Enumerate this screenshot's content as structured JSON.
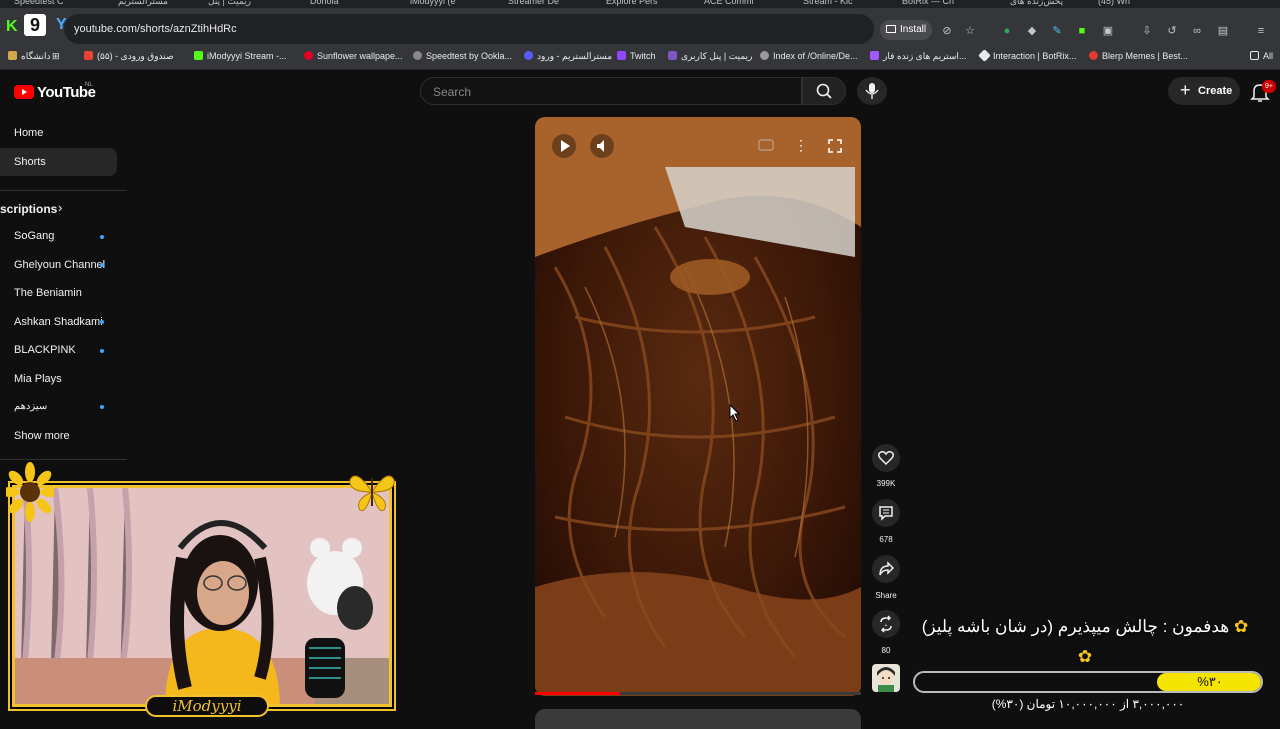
{
  "browser": {
    "tabs": [
      "Speedtest C",
      "مسترالستریم",
      "ریمیت | پنل",
      "Donola",
      "iModyyyi (e",
      "Streamer De",
      "Explore Pers",
      "ACE Commi",
      "Stream - Kic",
      "BotRix — Ch",
      "پخش‌زنده های",
      "(45) Wh"
    ],
    "url": "youtube.com/shorts/aznZtihHdRc",
    "install_label": "Install",
    "bookmarks": [
      "دانشگاه",
      "صندوق ورودی - (۵۵)",
      "iModyyyi Stream -...",
      "Sunflower wallpape...",
      "Speedtest by Ookla...",
      "مسترالستریم - ورود",
      "Twitch",
      "ریمیت | پنل کاربری",
      "Index of /Online/De...",
      "استریم های زنده فار...",
      "Interaction | BotRix...",
      "Blerp Memes | Best..."
    ],
    "all_bookmarks_label": "All"
  },
  "youtube": {
    "logo_text": "YouTube",
    "region": "NL",
    "search_placeholder": "Search",
    "create_label": "Create",
    "notification_count": "9+"
  },
  "sidebar": {
    "items": [
      "Home",
      "Shorts"
    ],
    "subscriptions_label": "scriptions",
    "channels": [
      {
        "name": "SoGang",
        "new": true
      },
      {
        "name": "Ghelyoun Channel",
        "new": true
      },
      {
        "name": "The Beniamin",
        "new": false
      },
      {
        "name": "Ashkan Shadkami",
        "new": true
      },
      {
        "name": "BLACKPINK",
        "new": true
      },
      {
        "name": "Mia Plays",
        "new": false
      },
      {
        "name": "سیزدهم",
        "new": true
      }
    ],
    "show_more_label": "Show more"
  },
  "short": {
    "progress_fraction": 0.26,
    "actions": {
      "likes": "399K",
      "comments": "678",
      "share_label": "Share",
      "remix_count": "80"
    }
  },
  "stream_overlay": {
    "streamer_name": "iModyyyi",
    "goal_title": "هدفمون : چالش میپذیرم (در شان باشه پلیز)",
    "goal_fraction": 0.3,
    "goal_percent_label": "%۳۰",
    "goal_subtitle": "۳,۰۰۰,۰۰۰ از ۱۰,۰۰۰,۰۰۰ تومان (۳۰%)"
  },
  "colors": {
    "youtube_red": "#ff0000",
    "new_dot": "#3ea6ff",
    "overlay_gold": "#f2c12e",
    "goal_yellow": "#f5e300"
  }
}
